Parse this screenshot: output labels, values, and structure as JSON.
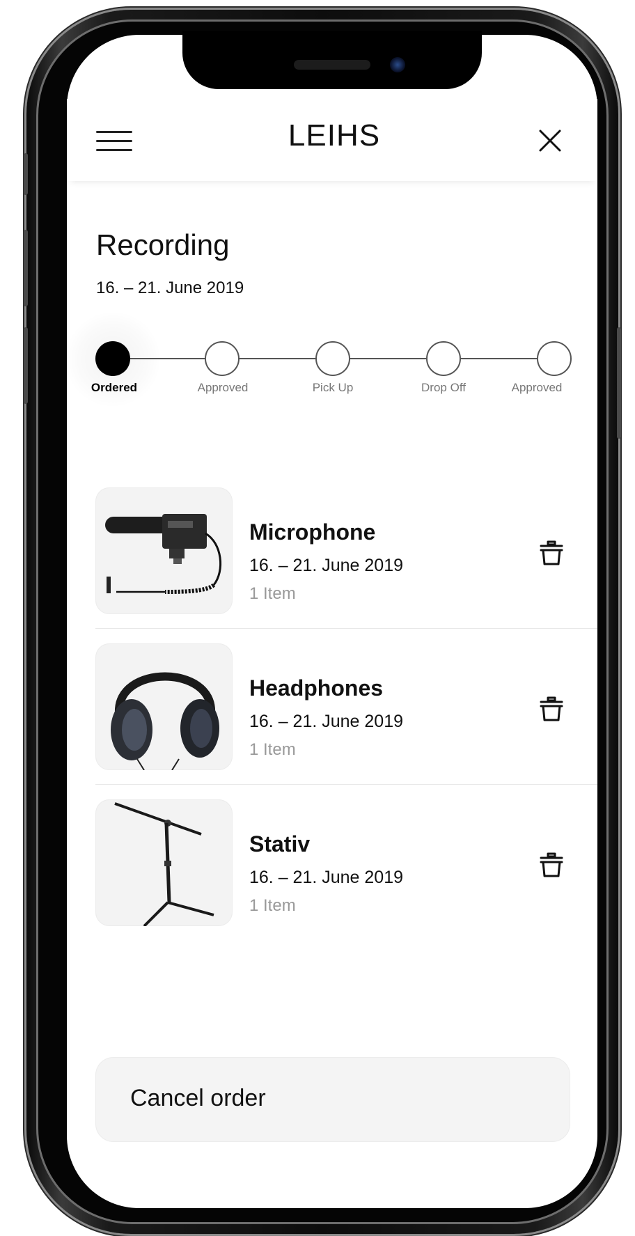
{
  "header": {
    "title": "LEIHS",
    "menu_icon": "hamburger-menu-icon",
    "close_icon": "close-icon"
  },
  "order": {
    "title": "Recording",
    "dates": "16. – 21. June 2019"
  },
  "stepper": {
    "steps": [
      {
        "label": "Ordered",
        "state": "active"
      },
      {
        "label": "Approved",
        "state": "inactive"
      },
      {
        "label": "Pick Up",
        "state": "inactive"
      },
      {
        "label": "Drop Off",
        "state": "inactive"
      },
      {
        "label": "Approved",
        "state": "inactive"
      }
    ]
  },
  "items": [
    {
      "name": "Microphone",
      "dates": "16. – 21. June 2019",
      "quantity": "1 Item",
      "image": "shotgun-microphone",
      "action_icon": "trash-icon"
    },
    {
      "name": "Headphones",
      "dates": "16. – 21. June 2019",
      "quantity": "1 Item",
      "image": "headphones",
      "action_icon": "trash-icon"
    },
    {
      "name": "Stativ",
      "dates": "16. – 21. June 2019",
      "quantity": "1 Item",
      "image": "microphone-stand",
      "action_icon": "trash-icon"
    }
  ],
  "footer": {
    "cancel_label": "Cancel order"
  },
  "colors": {
    "active_step": "#000000",
    "text": "#111111",
    "muted_text": "#999999",
    "button_bg": "#f4f4f4"
  }
}
